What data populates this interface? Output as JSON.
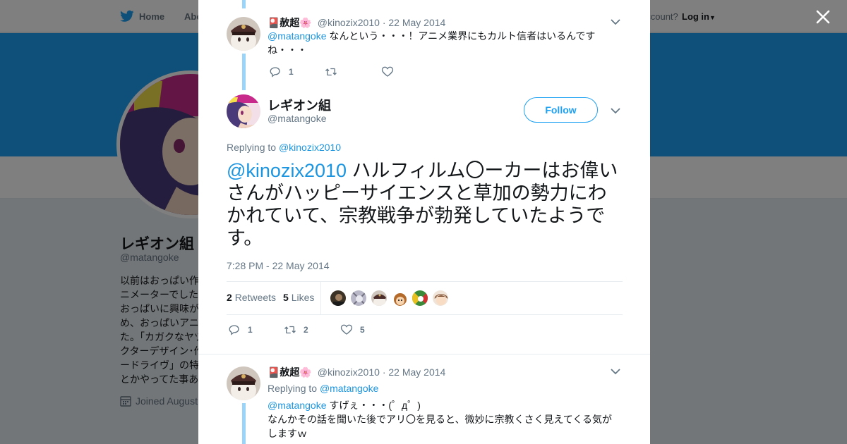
{
  "nav": {
    "home_label": "Home",
    "about_label": "Abo",
    "account_label": "account?",
    "login_label": "Log in"
  },
  "profile": {
    "name": "レギオン組",
    "handle": "@matangoke",
    "bio": "以前はおっぱい作\nニメーターでした\nおっぱいに興味が\nめ、おっぱいアニ\nた。「カガクなヤツ\nクターデザイン･作\nードライヴ」の特\nとかやってた事あ",
    "joined": "Joined August"
  },
  "modal": {
    "top_tweet": {
      "name": "🎴赦超🌸",
      "handle": "@kinozix2010",
      "date": "22 May 2014",
      "mention": "@matangoke",
      "text": " なんという・・・！アニメ業界にもカルト信者はいるんですね・・・",
      "reply_count": "1"
    },
    "main_tweet": {
      "name": "レギオン組",
      "handle": "@matangoke",
      "follow_label": "Follow",
      "replying_prefix": "Replying to",
      "replying_to": "@kinozix2010",
      "mention": "@kinozix2010",
      "text": " ハルフィルム〇ーカーはお偉いさんがハッピーサイエンスと草加の勢力にわかれていて、宗教戦争が勃発していたようです。",
      "timestamp": "7:28 PM - 22 May 2014",
      "retweets_count": "2",
      "retweets_label": "Retweets",
      "likes_count": "5",
      "likes_label": "Likes",
      "reply_count": "1",
      "retweet_count": "2",
      "like_count": "5"
    },
    "reply_tweet": {
      "name": "🎴赦超🌸",
      "handle": "@kinozix2010",
      "date": "22 May 2014",
      "replying_prefix": "Replying to",
      "replying_to": "@matangoke",
      "mention": "@matangoke",
      "text_line1": " すげぇ・・・(゜д゜)",
      "text_rest": "なんかその話を聞いた後でアリ〇を見ると、微妙に宗教くさく見えてくる気がしますｗ"
    }
  },
  "colors": {
    "accent": "#1da1f2",
    "link": "#1b95e0",
    "muted": "#657786",
    "thread_line": "#9ad5f9"
  },
  "icons": [
    "twitter-bird-icon",
    "close-icon",
    "reply-icon",
    "retweet-icon",
    "heart-icon",
    "chevron-down-icon",
    "calendar-icon"
  ]
}
